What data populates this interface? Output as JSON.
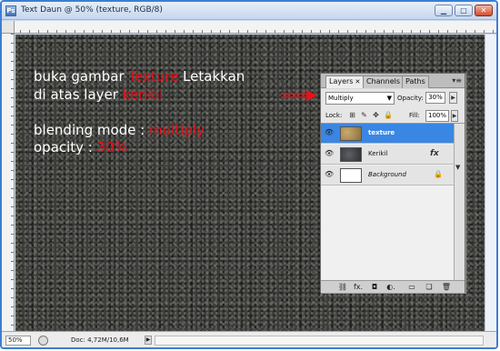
{
  "window": {
    "title": "Text Daun @ 50% (texture, RGB/8)",
    "app_icon": "Ps",
    "min": "▁",
    "max": "□",
    "close": "✕"
  },
  "overlay": {
    "line1_a": "buka gambar ",
    "line1_b": "Texture",
    "line1_c": " Letakkan",
    "line2_a": "di atas layer ",
    "line2_b": "kerikil",
    "line3_a": "blending mode : ",
    "line3_b": "multiply",
    "line4_a": "opacity : ",
    "line4_b": "30%"
  },
  "status": {
    "zoom": "50%",
    "doc": "Doc: 4,72M/10,6M",
    "arrow": "▶"
  },
  "layers_panel": {
    "tabs": [
      {
        "label": "Layers",
        "close": "✕"
      },
      {
        "label": "Channels"
      },
      {
        "label": "Paths"
      }
    ],
    "menu": "▾≡",
    "blend_mode": "Multiply",
    "blend_dd": "▼",
    "opacity_label": "Opacity:",
    "opacity_value": "30%",
    "lock_label": "Lock:",
    "fill_label": "Fill:",
    "fill_value": "100%",
    "layers": [
      {
        "name": "texture",
        "selected": true
      },
      {
        "name": "Kerikil",
        "fx": "fx"
      },
      {
        "name": "Background",
        "locked": true
      }
    ],
    "footer": {
      "link": "⛓",
      "fx": "fx.",
      "mask": "◘",
      "adjust": "◐.",
      "group": "▭",
      "new": "❏",
      "trash": "🗑"
    }
  },
  "colors": {
    "accent": "#e8101a",
    "selection": "#3a86e3",
    "window_border": "#3c7fd2"
  }
}
